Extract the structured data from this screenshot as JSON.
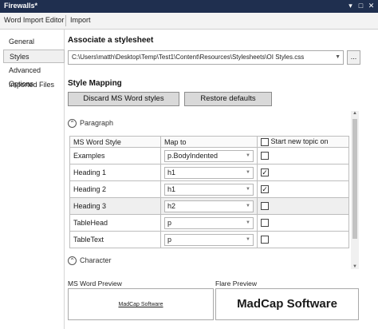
{
  "window": {
    "title": "Firewalls*",
    "controls": [
      "▾",
      "□",
      "✕"
    ]
  },
  "tabs": [
    {
      "label": "Word Import Editor"
    },
    {
      "label": "Import"
    }
  ],
  "sidebar": {
    "items": [
      {
        "label": "General",
        "selected": false
      },
      {
        "label": "Styles",
        "selected": true
      },
      {
        "label": "Advanced Options",
        "selected": false
      },
      {
        "label": "Imported Files",
        "selected": false
      }
    ]
  },
  "stylesheet": {
    "heading": "Associate a stylesheet",
    "path": "C:\\Users\\matth\\Desktop\\Temp\\Test1\\Content\\Resources\\Stylesheets\\OI Styles.css",
    "browse_label": "..."
  },
  "mapping": {
    "heading": "Style Mapping",
    "discard_label": "Discard MS Word styles",
    "restore_label": "Restore defaults",
    "paragraph_label": "Paragraph",
    "character_label": "Character",
    "columns": [
      "MS Word Style",
      "Map to",
      "Start new topic on"
    ],
    "rows": [
      {
        "style": "Examples",
        "map_to": "p.BodyIndented",
        "new_topic": false
      },
      {
        "style": "Heading 1",
        "map_to": "h1",
        "new_topic": true
      },
      {
        "style": "Heading 2",
        "map_to": "h1",
        "new_topic": true
      },
      {
        "style": "Heading 3",
        "map_to": "h2",
        "new_topic": false
      },
      {
        "style": "TableHead",
        "map_to": "p",
        "new_topic": false
      },
      {
        "style": "TableText",
        "map_to": "p",
        "new_topic": false
      }
    ]
  },
  "preview": {
    "word_label": "MS Word Preview",
    "flare_label": "Flare Preview",
    "word_text": "MadCap Software",
    "flare_text": "MadCap Software"
  },
  "icons": {
    "collapse": "⌃",
    "dropdown": "▼",
    "check": "✓"
  }
}
